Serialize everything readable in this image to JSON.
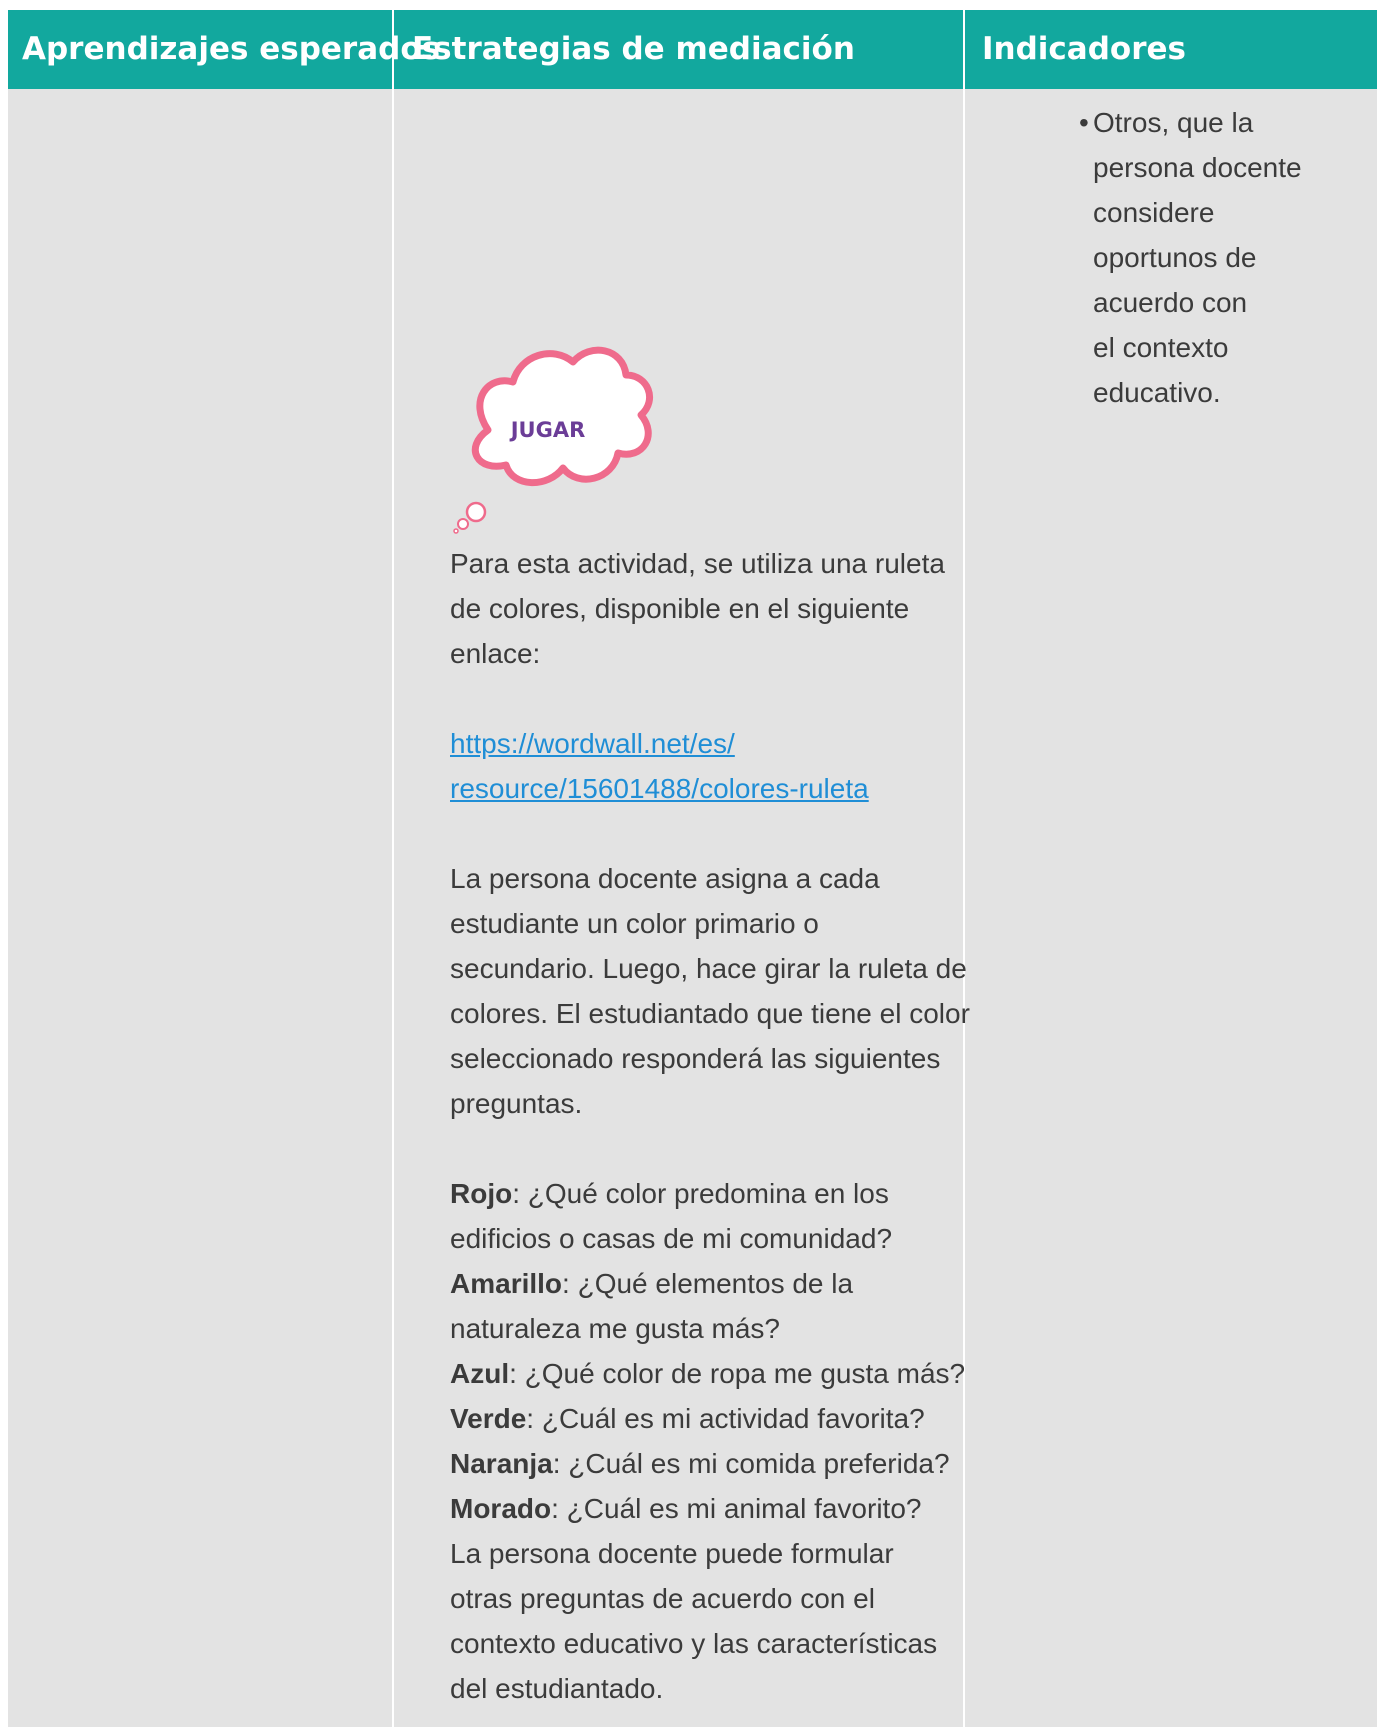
{
  "header": {
    "col1": "Aprendizajes esperados",
    "col2": "Estrategias de mediación",
    "col3": "Indicadores"
  },
  "indicators": {
    "item": [
      "Otros, que la",
      "persona docente",
      "considere",
      "oportunos de",
      "acuerdo con",
      "el contexto",
      "educativo."
    ]
  },
  "badge": {
    "label": "JUGAR",
    "color": "#ef6b8c",
    "text_color": "#6b3d97"
  },
  "intro": [
    "Para esta actividad, se utiliza una ruleta",
    "de colores, disponible en el siguiente",
    "enlace:"
  ],
  "link": [
    "https://wordwall.net/es/",
    "resource/15601488/colores-ruleta"
  ],
  "instructions": [
    "La persona docente asigna a cada",
    "estudiante un color primario o",
    "secundario. Luego, hace girar la ruleta de",
    "colores. El estudiantado que tiene el color",
    "seleccionado responderá las siguientes",
    "preguntas."
  ],
  "questions": [
    {
      "color": "Rojo",
      "text": ": ¿Qué color predomina en los"
    },
    {
      "color": "",
      "text": "edificios o casas de mi comunidad?"
    },
    {
      "color": "Amarillo",
      "text": ": ¿Qué elementos de la"
    },
    {
      "color": "",
      "text": "naturaleza me gusta más?"
    },
    {
      "color": "Azul",
      "text": ": ¿Qué color de ropa me gusta más?"
    },
    {
      "color": "Verde",
      "text": ": ¿Cuál es mi actividad favorita?"
    },
    {
      "color": "Naranja",
      "text": ": ¿Cuál es mi comida preferida?"
    },
    {
      "color": "Morado",
      "text": ": ¿Cuál es mi animal favorito?"
    }
  ],
  "closing": [
    "La persona docente puede formular",
    "otras preguntas de acuerdo con el",
    "contexto educativo y las características",
    "del estudiantado."
  ],
  "colors": {
    "header_bg": "#12a89e",
    "cell_bg": "#e3e3e3",
    "link": "#1f8ed6",
    "text": "#3b3b3b"
  }
}
